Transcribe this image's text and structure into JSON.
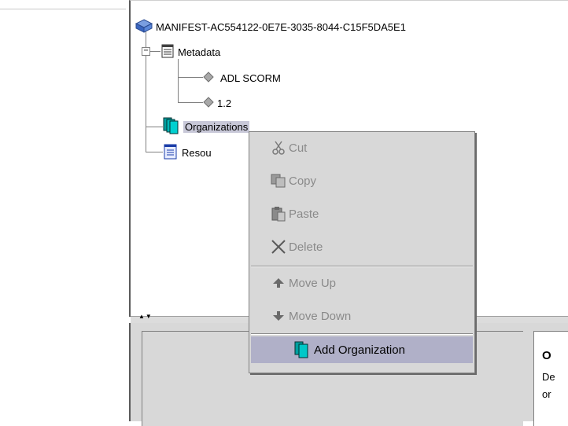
{
  "tree": {
    "root": {
      "label": "MANIFEST-AC554122-0E7E-3035-8044-C15F5DA5E1",
      "icon": "package-icon"
    },
    "metadata": {
      "label": "Metadata",
      "icon": "metadata-document-icon"
    },
    "schema": {
      "label": "ADL SCORM",
      "icon": "diamond-leaf-icon"
    },
    "version": {
      "label": "1.2",
      "icon": "diamond-leaf-icon"
    },
    "organizations": {
      "label": "Organizations",
      "icon": "organizations-icon"
    },
    "resources": {
      "label": "Resou",
      "icon": "resources-icon"
    }
  },
  "context_menu": {
    "cut": "Cut",
    "copy": "Copy",
    "paste": "Paste",
    "delete": "Delete",
    "move_up": "Move Up",
    "move_down": "Move Down",
    "add_organization": "Add Organization"
  },
  "info_panel": {
    "title": "O",
    "line1": "De",
    "line2": "or"
  },
  "colors": {
    "selection": "#c8c8d8",
    "menu_highlight": "#b0b0c8",
    "menu_background": "#d8d8d8",
    "disabled_text": "#8a8a8a",
    "organizations_icon": "#00a0a0"
  }
}
